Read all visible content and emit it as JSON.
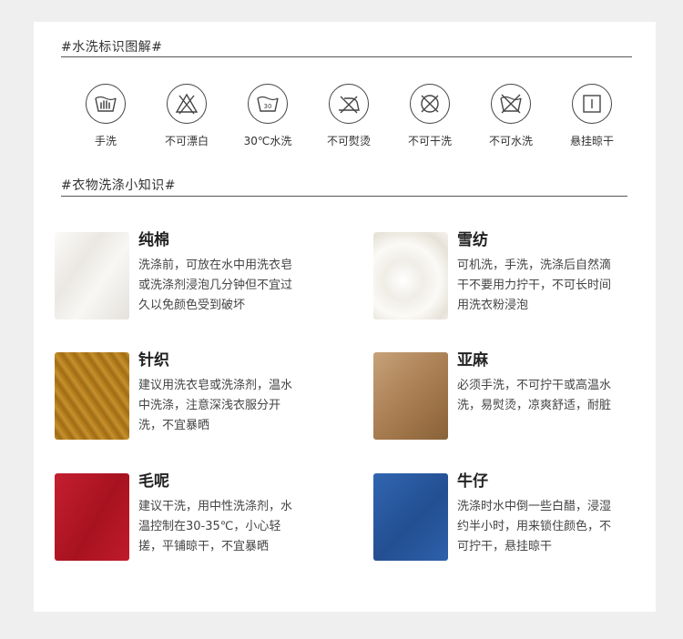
{
  "sections": {
    "wash_symbols_title": "#水洗标识图解#",
    "fabric_tips_title": "#衣物洗涤小知识#"
  },
  "symbols": [
    {
      "icon": "hand-wash-icon",
      "label": "手洗"
    },
    {
      "icon": "no-bleach-icon",
      "label": "不可漂白"
    },
    {
      "icon": "wash-30-icon",
      "label": "30℃水洗",
      "temp": "30"
    },
    {
      "icon": "no-iron-icon",
      "label": "不可熨烫"
    },
    {
      "icon": "no-dry-clean-icon",
      "label": "不可干洗"
    },
    {
      "icon": "no-wash-icon",
      "label": "不可水洗"
    },
    {
      "icon": "hang-dry-shade-icon",
      "label": "悬挂晾干"
    }
  ],
  "fabrics": [
    {
      "name": "纯棉",
      "desc": "洗涤前，可放在水中用洗衣皂或洗涤剂浸泡几分钟但不宜过久以免颜色受到破坏",
      "color": "#f1efec"
    },
    {
      "name": "雪纺",
      "desc": "可机洗，手洗，洗涤后自然滴干不要用力拧干，不可长时间用洗衣粉浸泡",
      "color": "#f7f5ef"
    },
    {
      "name": "针织",
      "desc": "建议用洗衣皂或洗涤剂，温水中洗涤，注意深浅衣服分开洗，不宜暴晒",
      "color": "#b47d1e"
    },
    {
      "name": "亚麻",
      "desc": "必须手洗，不可拧干或高温水洗，易熨烫，凉爽舒适，耐脏",
      "color": "#b48b5e"
    },
    {
      "name": "毛呢",
      "desc": "建议干洗，用中性洗涤剂，水温控制在30-35℃，小心轻搓，平铺晾干，不宜暴晒",
      "color": "#b5192a"
    },
    {
      "name": "牛仔",
      "desc": "洗涤时水中倒一些白醋，浸湿约半小时，用来锁住颜色，不可拧干，悬挂晾干",
      "color": "#2a5ba6"
    }
  ]
}
